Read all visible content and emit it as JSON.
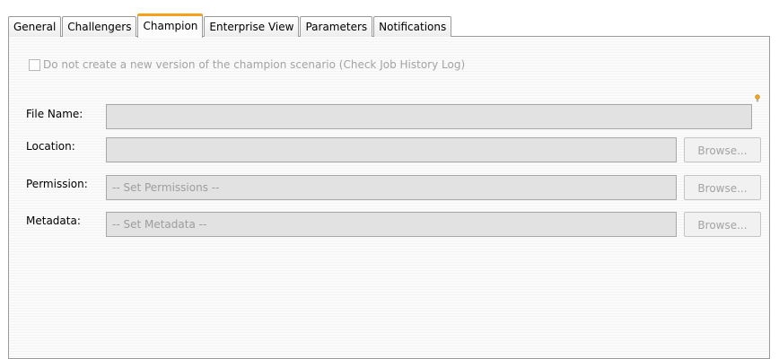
{
  "tabs": [
    {
      "label": "General"
    },
    {
      "label": "Challengers"
    },
    {
      "label": "Champion",
      "active": true
    },
    {
      "label": "Enterprise View"
    },
    {
      "label": "Parameters"
    },
    {
      "label": "Notifications"
    }
  ],
  "options": {
    "no_new_version_label": "Do not create a new version of the champion scenario (Check Job History Log)",
    "no_new_version_checked": false,
    "enabled": false
  },
  "form": {
    "file_name": {
      "label": "File Name:",
      "value": ""
    },
    "location": {
      "label": "Location:",
      "value": "",
      "button": "Browse..."
    },
    "permission": {
      "label": "Permission:",
      "placeholder": "-- Set Permissions --",
      "button": "Browse..."
    },
    "metadata": {
      "label": "Metadata:",
      "placeholder": "-- Set Metadata --",
      "button": "Browse..."
    }
  },
  "colors": {
    "active_tab_accent": "#f7a11b",
    "hint_icon": "#f2a51c",
    "disabled_text": "#a3a3a3",
    "input_background": "#e2e2e2"
  },
  "icons": {
    "required_hint": "lightbulb-icon"
  }
}
